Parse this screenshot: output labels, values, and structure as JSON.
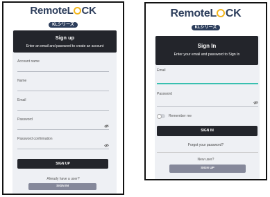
{
  "brand": {
    "name_part1": "Remote",
    "name_part2": "L",
    "name_part3": "CK",
    "badge": "KLシリーズ"
  },
  "signup": {
    "title": "Sign up",
    "subtitle": "Enter an email and password to create an account",
    "fields": {
      "account_name": "Account name",
      "name": "Name",
      "email": "Email",
      "password": "Password",
      "password_confirmation": "Password confirmation"
    },
    "submit_label": "SIGN UP",
    "already_text": "Already have a user?",
    "signin_label": "SIGN IN"
  },
  "signin": {
    "title": "Sign In",
    "subtitle": "Enter your email and password to Sign In",
    "fields": {
      "email": "Email",
      "password": "Password"
    },
    "remember_label": "Remember me",
    "remember_checked": false,
    "submit_label": "SIGN IN",
    "forgot_label": "Forgot your password?",
    "new_user_text": "New user?",
    "signup_label": "SIGN UP"
  },
  "colors": {
    "logo_navy": "#2d3e5c",
    "logo_gold": "#f3b61b",
    "dark_button": "#23252b",
    "gray_button": "#85889a",
    "focus_teal": "#39c0b0"
  },
  "icons": {
    "password_visibility": "eye-slash-icon"
  }
}
